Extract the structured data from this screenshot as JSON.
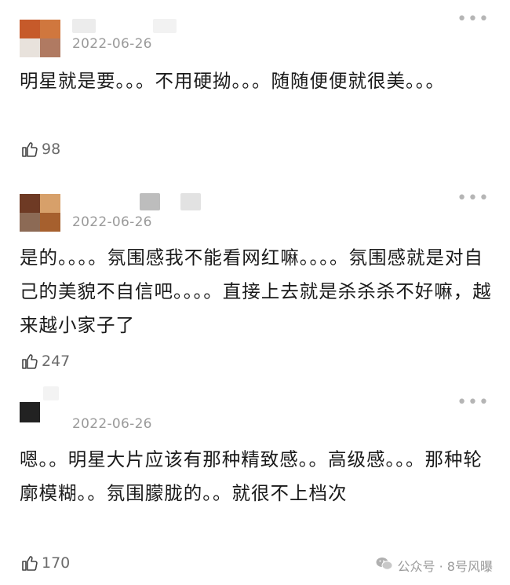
{
  "comments": [
    {
      "date": "2022-06-26",
      "text": "明星就是要。。。不用硬拗。。。随随便便就很美。。。",
      "likes": "98",
      "avatar_colors": [
        "#c65a2a",
        "#d0773e",
        "#e8e2dc",
        "#b07a62"
      ]
    },
    {
      "date": "2022-06-26",
      "text": "是的。。。。氛围感我不能看网红嘛。。。。氛围感就是对自己的美貌不自信吧。。。。直接上去就是杀杀杀不好嘛，越来越小家子了",
      "likes": "247",
      "avatar_colors": [
        "#6e3a24",
        "#d7a06a",
        "#8c6a55",
        "#a6602e"
      ]
    },
    {
      "date": "2022-06-26",
      "text": "嗯。。明星大片应该有那种精致感。。高级感。。。那种轮廓模糊。。氛围朦胧的。。就很不上档次",
      "likes": "170",
      "avatar_colors": [
        "#222222",
        "#222222",
        "#222222",
        "#222222"
      ]
    }
  ],
  "watermark": "公众号 · 8号风曝",
  "icons": {
    "like": "thumbs-up-icon",
    "more": "more-dots-icon",
    "wechat": "wechat-icon"
  }
}
